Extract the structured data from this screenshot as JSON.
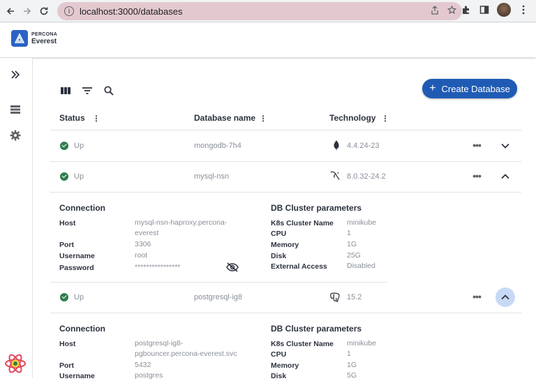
{
  "browser": {
    "url": "localhost:3000/databases"
  },
  "app": {
    "brand_top": "PERCONA",
    "brand_bottom": "Everest"
  },
  "toolbar": {
    "create_label": "Create Database"
  },
  "table": {
    "columns": [
      "Status",
      "Database name",
      "Technology"
    ],
    "rows": [
      {
        "status": "Up",
        "name": "mongodb-7h4",
        "version": "4.4.24-23",
        "tech_icon": "mongodb-icon",
        "expanded": false
      },
      {
        "status": "Up",
        "name": "mysql-nsn",
        "version": "8.0.32-24.2",
        "tech_icon": "mysql-icon",
        "expanded": true
      },
      {
        "status": "Up",
        "name": "postgresql-ig8",
        "version": "15.2",
        "tech_icon": "postgresql-icon",
        "expanded": true
      }
    ]
  },
  "details": [
    {
      "connection_title": "Connection",
      "cluster_title": "DB Cluster parameters",
      "host_label": "Host",
      "host_line1": "mysql-nsn-haproxy.percona-",
      "host_line2": "everest",
      "port_label": "Port",
      "port": "3306",
      "username_label": "Username",
      "username": "root",
      "password_label": "Password",
      "password": "****************",
      "k8s_label": "K8s Cluster Name",
      "k8s": "minikube",
      "cpu_label": "CPU",
      "cpu": "1",
      "memory_label": "Memory",
      "memory": "1G",
      "disk_label": "Disk",
      "disk": "25G",
      "external_label": "External Access",
      "external": "Disabled"
    },
    {
      "connection_title": "Connection",
      "cluster_title": "DB Cluster parameters",
      "host_label": "Host",
      "host_line1": "postgresql-ig8-",
      "host_line2": "pgbouncer.percona-everest.svc",
      "port_label": "Port",
      "port": "5432",
      "username_label": "Username",
      "username": "postgres",
      "k8s_label": "K8s Cluster Name",
      "k8s": "minikube",
      "cpu_label": "CPU",
      "cpu": "1",
      "memory_label": "Memory",
      "memory": "1G",
      "disk_label": "Disk",
      "disk": "5G"
    }
  ],
  "colors": {
    "accent": "#1f5bb4",
    "status_up": "#2e7d4f",
    "omnibox": "#e3c9cf"
  }
}
